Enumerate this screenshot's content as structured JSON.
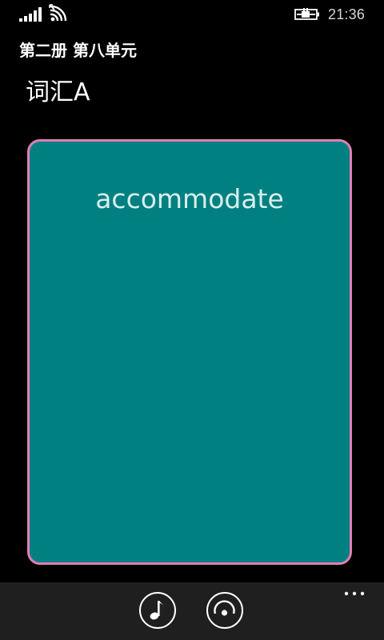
{
  "status_bar": {
    "time": "21:36",
    "icons": [
      "signal-icon",
      "wifi-icon",
      "battery-charging-icon"
    ]
  },
  "header": {
    "app_title": "第二册 第八单元",
    "page_title": "词汇A"
  },
  "card": {
    "word": "accommodate",
    "background_color": "#008080",
    "border_color": "#e37eb5"
  },
  "app_bar": {
    "buttons": [
      "music-note-icon",
      "play-circle-icon"
    ],
    "more_icon": "ellipsis-icon"
  }
}
